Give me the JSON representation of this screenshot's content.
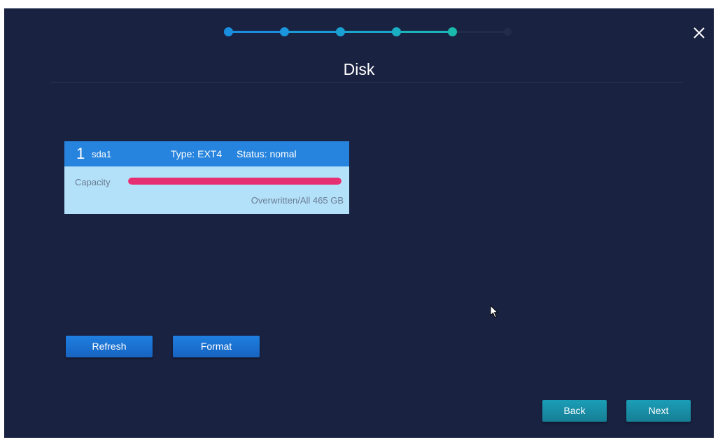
{
  "window": {
    "close_icon": "close-icon",
    "title": "Disk"
  },
  "wizard": {
    "total_steps": 6,
    "current_step": 5,
    "colors": {
      "completed": [
        "#1a8fe0",
        "#1a95de",
        "#1aa1d4",
        "#1aaec2",
        "#1ab9ad"
      ],
      "pending": "#222c4a"
    }
  },
  "disk": {
    "index": "1",
    "name": "sda1",
    "type": "Type: EXT4",
    "status": "Status: nomal",
    "capacity_label": "Capacity",
    "capacity_used_fraction": 1.0,
    "capacity_text": "Overwritten/All 465 GB",
    "colors": {
      "header": "#2784de",
      "body": "#b3e1f9",
      "bar": "#e62e72"
    }
  },
  "actions": {
    "refresh": "Refresh",
    "format": "Format"
  },
  "navigation": {
    "back": "Back",
    "next": "Next"
  }
}
